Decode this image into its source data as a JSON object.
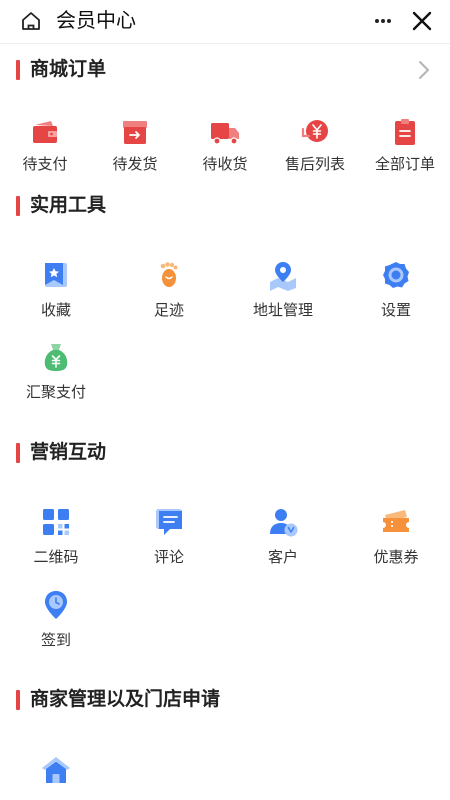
{
  "header": {
    "title": "会员中心"
  },
  "sections": {
    "orders": {
      "title": "商城订单",
      "items": [
        "待支付",
        "待发货",
        "待收货",
        "售后列表",
        "全部订单"
      ]
    },
    "tools": {
      "title": "实用工具",
      "items": [
        "收藏",
        "足迹",
        "地址管理",
        "设置",
        "汇聚支付"
      ]
    },
    "marketing": {
      "title": "营销互动",
      "items": [
        "二维码",
        "评论",
        "客户",
        "优惠券",
        "签到"
      ]
    },
    "merchant": {
      "title": "商家管理以及门店申请"
    }
  },
  "colors": {
    "accent": "#e64545",
    "blue": "#3d7ff2",
    "orange": "#f5913b",
    "green": "#4dbd74"
  }
}
